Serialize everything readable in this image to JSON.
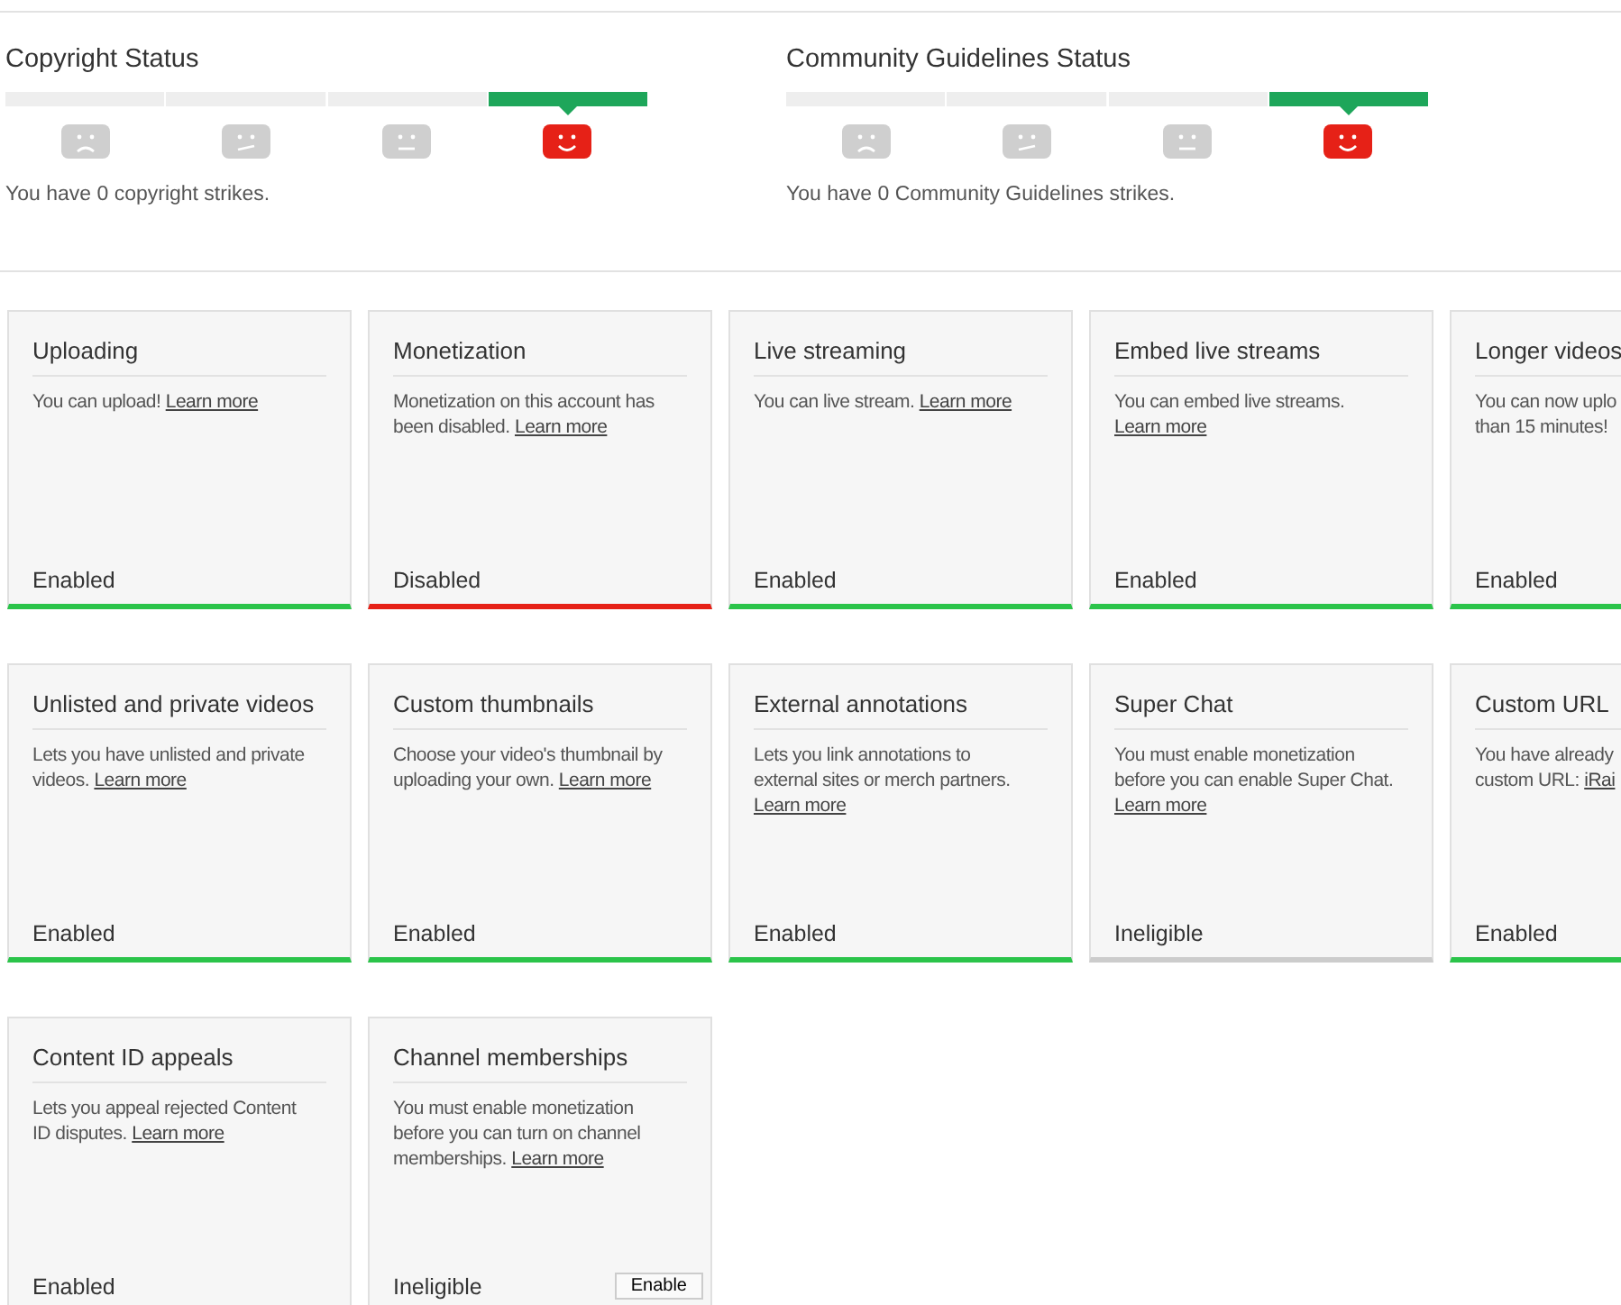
{
  "status_sections": [
    {
      "title": "Copyright Status",
      "faces": [
        {
          "kind": "sad",
          "selected": false
        },
        {
          "kind": "skeptical",
          "selected": false
        },
        {
          "kind": "neutral",
          "selected": false
        },
        {
          "kind": "happy",
          "selected": true
        }
      ],
      "summary": "You have 0 copyright strikes."
    },
    {
      "title": "Community Guidelines Status",
      "faces": [
        {
          "kind": "sad",
          "selected": false
        },
        {
          "kind": "skeptical",
          "selected": false
        },
        {
          "kind": "neutral",
          "selected": false
        },
        {
          "kind": "happy",
          "selected": true
        }
      ],
      "summary": "You have 0 Community Guidelines strikes."
    }
  ],
  "features": [
    {
      "title": "Uploading",
      "lines": [
        "You can upload!"
      ],
      "link": "Learn more",
      "link_own_line": false,
      "status": "Enabled",
      "kind": "enabled"
    },
    {
      "title": "Monetization",
      "lines": [
        "Monetization on this account has",
        "been disabled."
      ],
      "link": "Learn more",
      "link_own_line": false,
      "status": "Disabled",
      "kind": "disabled"
    },
    {
      "title": "Live streaming",
      "lines": [
        "You can live stream."
      ],
      "link": "Learn more",
      "link_own_line": false,
      "status": "Enabled",
      "kind": "enabled"
    },
    {
      "title": "Embed live streams",
      "lines": [
        "You can embed live streams."
      ],
      "link": "Learn more",
      "link_own_line": true,
      "status": "Enabled",
      "kind": "enabled"
    },
    {
      "title": "Longer videos",
      "lines": [
        "You can now uplo",
        "than 15 minutes!"
      ],
      "status": "Enabled",
      "kind": "enabled"
    },
    {
      "title": "Unlisted and private videos",
      "lines": [
        "Lets you have unlisted and private",
        "videos."
      ],
      "link": "Learn more",
      "link_own_line": false,
      "status": "Enabled",
      "kind": "enabled"
    },
    {
      "title": "Custom thumbnails",
      "lines": [
        "Choose your video's thumbnail by",
        "uploading your own."
      ],
      "link": "Learn more",
      "link_own_line": false,
      "status": "Enabled",
      "kind": "enabled"
    },
    {
      "title": "External annotations",
      "lines": [
        "Lets you link annotations to",
        "external sites or merch partners."
      ],
      "link": "Learn more",
      "link_own_line": true,
      "status": "Enabled",
      "kind": "enabled"
    },
    {
      "title": "Super Chat",
      "lines": [
        "You must enable monetization",
        "before you can enable Super Chat."
      ],
      "link": "Learn more",
      "link_own_line": true,
      "status": "Ineligible",
      "kind": "ineligible"
    },
    {
      "title": "Custom URL",
      "lines": [
        "You have already",
        "custom URL:"
      ],
      "link": "iRai",
      "link_own_line": false,
      "status": "Enabled",
      "kind": "enabled"
    },
    {
      "title": "Content ID appeals",
      "lines": [
        "Lets you appeal rejected Content",
        "ID disputes."
      ],
      "link": "Learn more",
      "link_own_line": false,
      "status": "Enabled",
      "kind": "enabled"
    },
    {
      "title": "Channel memberships",
      "lines": [
        "You must enable monetization",
        "before you can turn on channel",
        "memberships."
      ],
      "link": "Learn more",
      "link_own_line": false,
      "status": "Ineligible",
      "kind": "ineligible",
      "button": "Enable"
    }
  ]
}
